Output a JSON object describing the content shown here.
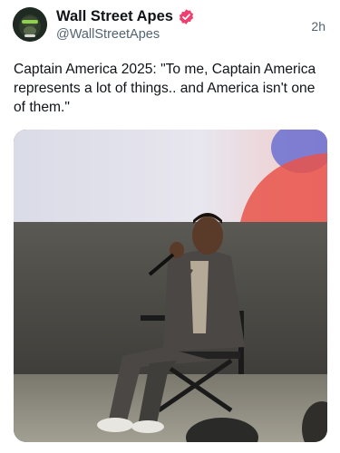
{
  "author": {
    "display_name": "Wall Street Apes",
    "handle": "@WallStreetApes",
    "verified": true,
    "avatar_icon": "gorilla-avatar"
  },
  "timestamp": "2h",
  "tweet": {
    "text": "Captain America 2025: \"To me, Captain America represents a lot of things.. and America isn't one of them.\""
  },
  "media": {
    "type": "video-still",
    "description_icon": "video-thumbnail"
  },
  "colors": {
    "verified_badge": "#ef3e6f",
    "secondary_text": "#536471",
    "primary_text": "#0f1419"
  }
}
